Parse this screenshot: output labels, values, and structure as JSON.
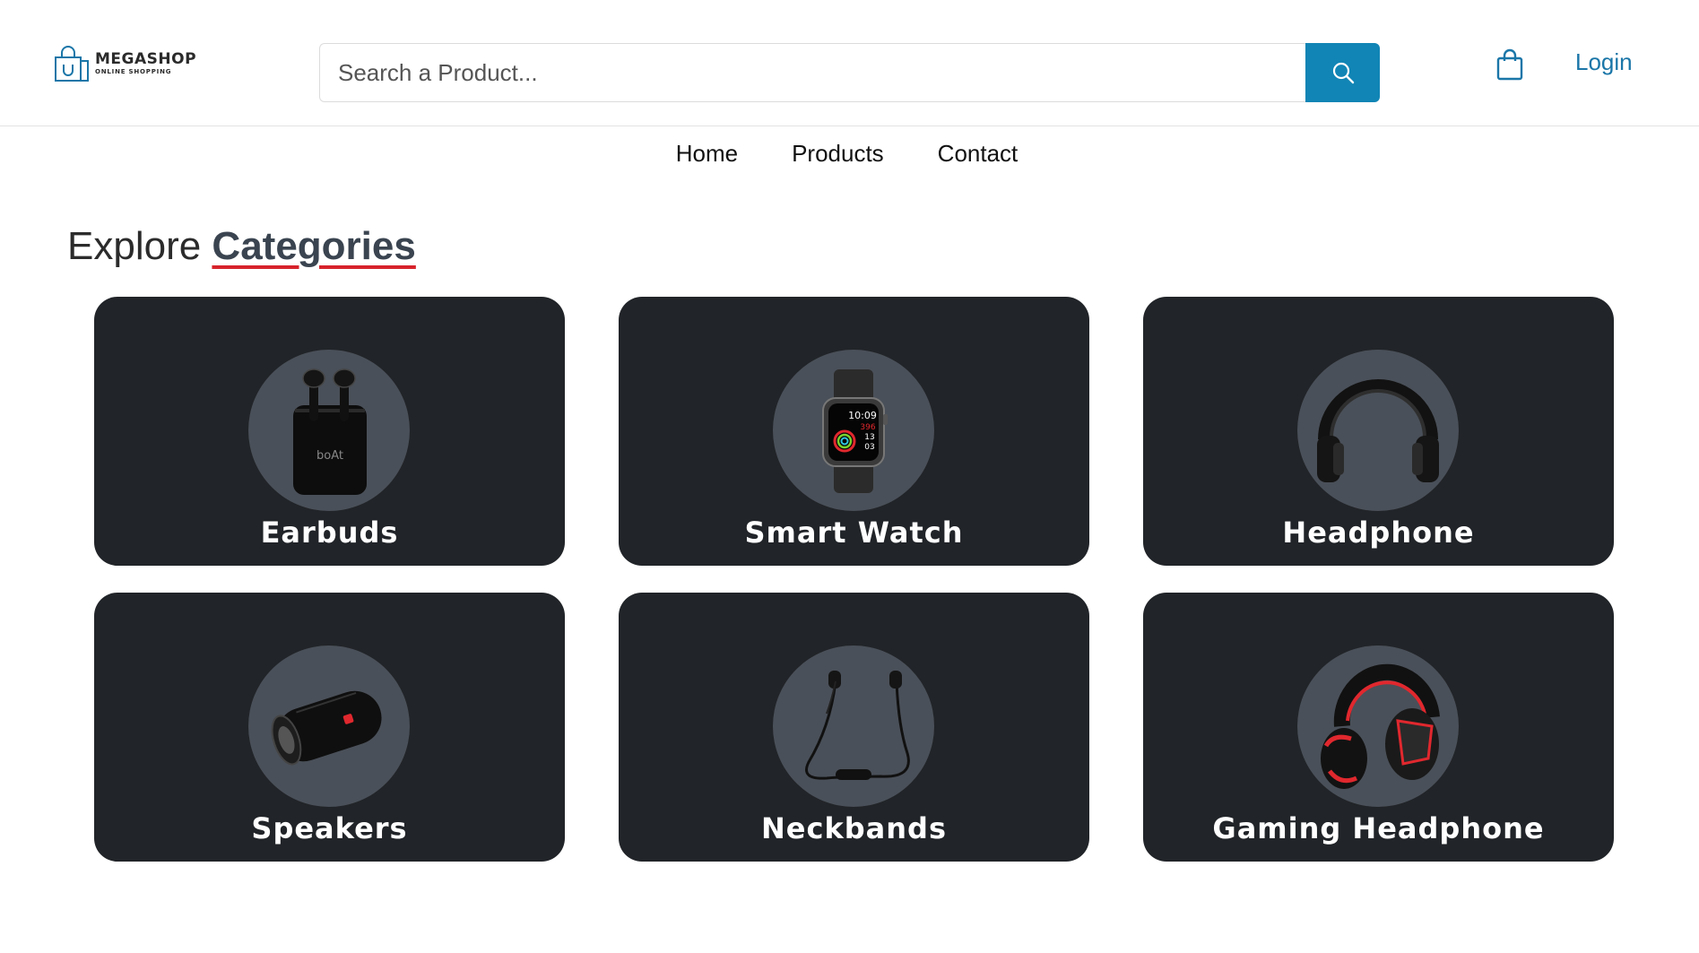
{
  "header": {
    "logo": {
      "title": "MEGASHOP",
      "subtitle": "ONLINE SHOPPING",
      "icon": "shopping-bag-icon"
    },
    "search": {
      "placeholder": "Search a Product...",
      "value": "",
      "button_icon": "search-icon"
    },
    "cart_icon": "shopping-bag-icon",
    "login_label": "Login",
    "accent_color": "#1185b5"
  },
  "nav": {
    "items": [
      {
        "label": "Home"
      },
      {
        "label": "Products"
      },
      {
        "label": "Contact"
      }
    ]
  },
  "section": {
    "title_plain": "Explore",
    "title_accent": "Categories"
  },
  "categories": [
    {
      "label": "Earbuds",
      "icon": "earbuds-icon"
    },
    {
      "label": "Smart Watch",
      "icon": "smart-watch-icon",
      "watch_face": {
        "time": "10:09",
        "line1": "396",
        "line2": "13",
        "line3": "03"
      }
    },
    {
      "label": "Headphone",
      "icon": "headphone-icon"
    },
    {
      "label": "Speakers",
      "icon": "speaker-icon"
    },
    {
      "label": "Neckbands",
      "icon": "neckband-icon"
    },
    {
      "label": "Gaming Headphone",
      "icon": "gaming-headphone-icon"
    }
  ]
}
